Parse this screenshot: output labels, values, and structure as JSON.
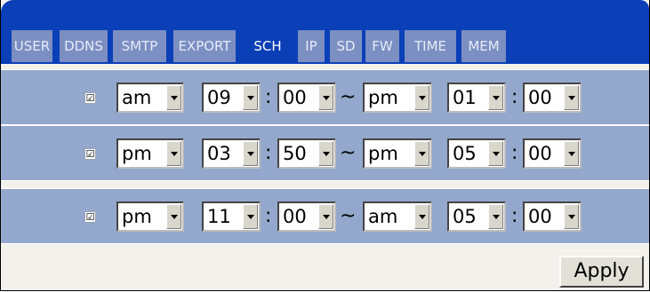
{
  "tabs": [
    "USER",
    "DDNS",
    "SMTP",
    "EXPORT",
    "SCH",
    "IP",
    "SD",
    "FW",
    "TIME",
    "MEM"
  ],
  "active_tab": "SCH",
  "colors": {
    "tab_bar": "#0a3fb8",
    "tab_inactive": "#7c8fc2",
    "row_background": "#93a8cc",
    "panel_background": "#f2f1ec"
  },
  "schedule": {
    "rows": [
      {
        "enabled": true,
        "start_ampm": "am",
        "start_hour": "09",
        "start_minute": "00",
        "end_ampm": "pm",
        "end_hour": "01",
        "end_minute": "00"
      },
      {
        "enabled": true,
        "start_ampm": "pm",
        "start_hour": "03",
        "start_minute": "50",
        "end_ampm": "pm",
        "end_hour": "05",
        "end_minute": "00"
      },
      {
        "enabled": true,
        "start_ampm": "pm",
        "start_hour": "11",
        "start_minute": "00",
        "end_ampm": "am",
        "end_hour": "05",
        "end_minute": "00"
      }
    ],
    "time_separator": ":",
    "range_separator": "~",
    "checked_mark": "☑"
  },
  "apply_label": "Apply"
}
